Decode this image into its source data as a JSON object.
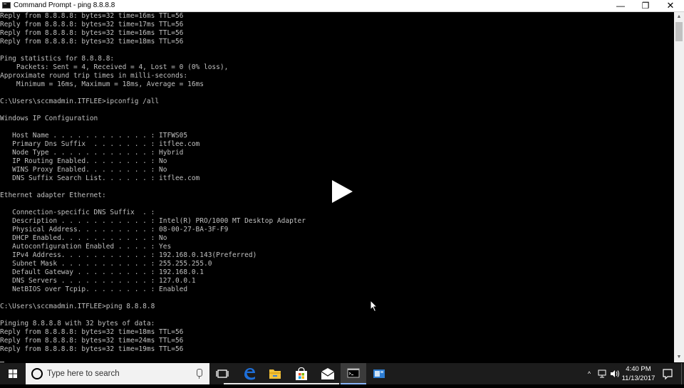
{
  "window": {
    "title": "Command Prompt - ping  8.8.8.8",
    "minimize_glyph": "—",
    "maximize_glyph": "❐",
    "close_glyph": "✕"
  },
  "console": {
    "text": "Reply from 8.8.8.8: bytes=32 time=16ms TTL=56\nReply from 8.8.8.8: bytes=32 time=17ms TTL=56\nReply from 8.8.8.8: bytes=32 time=16ms TTL=56\nReply from 8.8.8.8: bytes=32 time=18ms TTL=56\n\nPing statistics for 8.8.8.8:\n    Packets: Sent = 4, Received = 4, Lost = 0 (0% loss),\nApproximate round trip times in milli-seconds:\n    Minimum = 16ms, Maximum = 18ms, Average = 16ms\n\nC:\\Users\\sccmadmin.ITFLEE>ipconfig /all\n\nWindows IP Configuration\n\n   Host Name . . . . . . . . . . . . : ITFWS05\n   Primary Dns Suffix  . . . . . . . : itflee.com\n   Node Type . . . . . . . . . . . . : Hybrid\n   IP Routing Enabled. . . . . . . . : No\n   WINS Proxy Enabled. . . . . . . . : No\n   DNS Suffix Search List. . . . . . : itflee.com\n\nEthernet adapter Ethernet:\n\n   Connection-specific DNS Suffix  . :\n   Description . . . . . . . . . . . : Intel(R) PRO/1000 MT Desktop Adapter\n   Physical Address. . . . . . . . . : 08-00-27-BA-3F-F9\n   DHCP Enabled. . . . . . . . . . . : No\n   Autoconfiguration Enabled . . . . : Yes\n   IPv4 Address. . . . . . . . . . . : 192.168.0.143(Preferred)\n   Subnet Mask . . . . . . . . . . . : 255.255.255.0\n   Default Gateway . . . . . . . . . : 192.168.0.1\n   DNS Servers . . . . . . . . . . . : 127.0.0.1\n   NetBIOS over Tcpip. . . . . . . . : Enabled\n\nC:\\Users\\sccmadmin.ITFLEE>ping 8.8.8.8\n\nPinging 8.8.8.8 with 32 bytes of data:\nReply from 8.8.8.8: bytes=32 time=18ms TTL=56\nReply from 8.8.8.8: bytes=32 time=24ms TTL=56\nReply from 8.8.8.8: bytes=32 time=19ms TTL=56"
  },
  "scrollbar": {
    "up_glyph": "▲",
    "down_glyph": "▼",
    "position_fraction": 0.0
  },
  "taskbar": {
    "search_placeholder": "Type here to search",
    "tray_chevron": "^",
    "time": "4:40 PM",
    "date": "11/13/2017",
    "pinned_icons": [
      "task-view-icon",
      "edge-icon",
      "file-explorer-icon",
      "store-icon",
      "mail-icon",
      "command-prompt-icon",
      "app-icon"
    ]
  },
  "colors": {
    "console_bg": "#000000",
    "console_text": "#c0c0c0",
    "taskbar_bg": "#1c1c1c",
    "edge_blue": "#1e6fd9",
    "explorer_yellow": "#f3c23c",
    "accent": "#8ab4f8"
  }
}
